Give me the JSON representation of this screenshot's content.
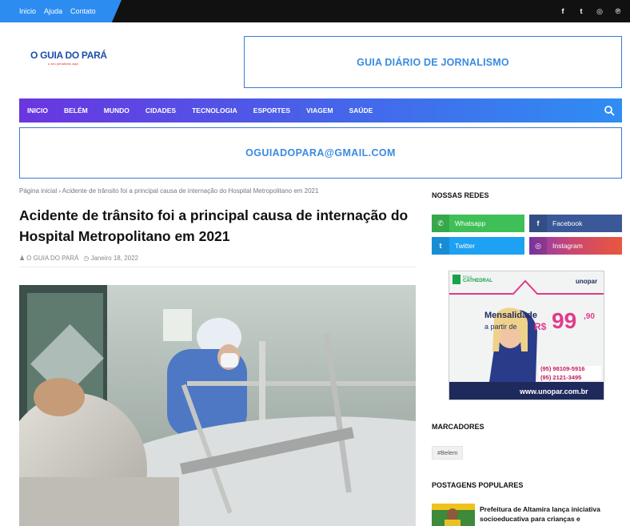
{
  "topbar": {
    "links": [
      "Inicio",
      "Ajuda",
      "Contato"
    ],
    "social_icons": [
      {
        "name": "facebook-icon",
        "glyph": "f"
      },
      {
        "name": "twitter-icon",
        "glyph": "t"
      },
      {
        "name": "instagram-icon",
        "glyph": "◎"
      },
      {
        "name": "pinterest-icon",
        "glyph": "℗"
      }
    ]
  },
  "header": {
    "logo_text": "O GUIA DO PARÁ",
    "logo_tagline": "o seu jornalismo aqui",
    "banner_text": "GUIA DIÁRIO DE JORNALISMO"
  },
  "nav": {
    "items": [
      "INICIO",
      "BELÉM",
      "MUNDO",
      "CIDADES",
      "TECNOLOGIA",
      "ESPORTES",
      "VIAGEM",
      "SAÚDE"
    ]
  },
  "banner2": {
    "text": "OGUIADOPARA@GMAIL.COM"
  },
  "article": {
    "breadcrumb": "Página inicial › Acidente de trânsito foi a principal causa de internação do Hospital Metropolitano em 2021",
    "title": "Acidente de trânsito foi a principal causa de internação do Hospital Metropolitano em 2021",
    "author": "O GUIA DO PARÁ",
    "date": "Janeiro 18, 2022"
  },
  "sidebar": {
    "networks_heading": "NOSSAS REDES",
    "networks": [
      {
        "label": "Whatsapp",
        "icon": "whatsapp-icon",
        "glyph": "✆",
        "color": "#3fbf57"
      },
      {
        "label": "Facebook",
        "icon": "facebook-icon",
        "glyph": "f",
        "color": "#3b5998"
      },
      {
        "label": "Twitter",
        "icon": "twitter-icon",
        "glyph": "t",
        "color": "#1da1f2"
      },
      {
        "label": "Instagram",
        "icon": "instagram-icon",
        "glyph": "◎",
        "color": "#c13584"
      }
    ],
    "ad": {
      "partner": "CATHEDRAL",
      "partner_prefix": "POLO",
      "brand": "unopar",
      "headline": "Mensalidade",
      "subline": "a partir de",
      "currency": "R$",
      "price": "99",
      "cents": ",90",
      "phone1": "(95) 98109-5916",
      "phone2": "(95) 2121-3495",
      "url": "www.unopar.com.br"
    },
    "tags_heading": "MARCADORES",
    "tags": [
      "#Belem"
    ],
    "popular_heading": "POSTAGENS POPULARES",
    "popular": [
      {
        "title": "Prefeitura de Altamira lança iniciativa socioeducativa para crianças e"
      }
    ]
  }
}
